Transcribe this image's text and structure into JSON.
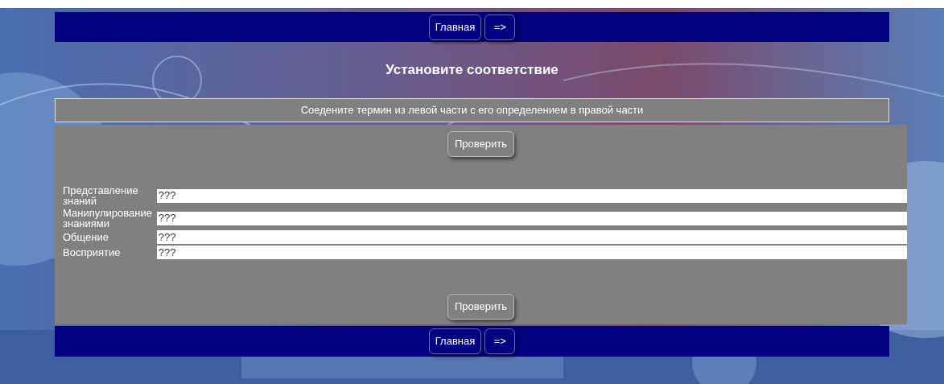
{
  "nav_top": {
    "buttons": [
      "Главная",
      "=>"
    ]
  },
  "title": "Установите соответствие",
  "instruction": "Соедените термин из левой части с его определением в правой части",
  "check_button_top": "Проверить",
  "pairs": [
    {
      "term": "Представление знаний",
      "value": "???"
    },
    {
      "term": "Манипулирование знаниями",
      "value": "???"
    },
    {
      "term": "Общение",
      "value": "???"
    },
    {
      "term": "Восприятие",
      "value": "???"
    }
  ],
  "check_button_bottom": "Проверить",
  "nav_bottom": {
    "buttons": [
      "Главная",
      "=>"
    ]
  }
}
